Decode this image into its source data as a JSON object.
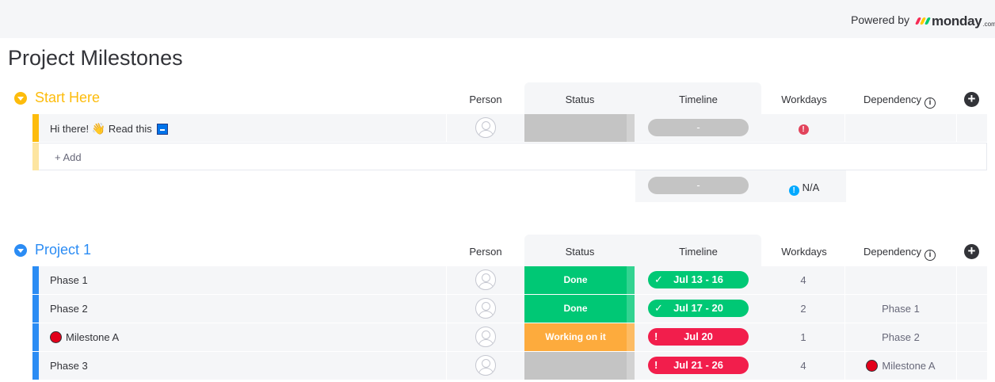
{
  "header": {
    "powered_by": "Powered by",
    "brand": "monday",
    "brand_suffix": ".com",
    "brand_colors": [
      "#f62b54",
      "#ffcb00",
      "#00ca72"
    ]
  },
  "page_title": "Project Milestones",
  "columns": {
    "person": "Person",
    "status": "Status",
    "timeline": "Timeline",
    "workdays": "Workdays",
    "dependency": "Dependency"
  },
  "groups": [
    {
      "title": "Start Here",
      "color": "#fdab3d",
      "title_color": "#fdbc0c",
      "rows": [
        {
          "name": "Hi there!",
          "name_suffix": "Read this",
          "status": "",
          "status_color": "#c4c4c4",
          "timeline": "-",
          "timeline_color": "#c4c4c4",
          "workdays_flag": "!",
          "dependency": ""
        }
      ],
      "add_label": "+ Add",
      "summary": {
        "timeline": "-",
        "workdays": "N/A"
      }
    },
    {
      "title": "Project 1",
      "color": "#579bfc",
      "title_color": "#2b8cf4",
      "rows": [
        {
          "name": "Phase 1",
          "status": "Done",
          "status_color": "#00c875",
          "timeline": "Jul 13 - 16",
          "timeline_color": "#00c875",
          "timeline_icon": "✓",
          "workdays": "4",
          "dependency": ""
        },
        {
          "name": "Phase 2",
          "status": "Done",
          "status_color": "#00c875",
          "timeline": "Jul 17 - 20",
          "timeline_color": "#00c875",
          "timeline_icon": "✓",
          "workdays": "2",
          "dependency": "Phase 1"
        },
        {
          "name": "Milestone A",
          "status": "Working on it",
          "status_color": "#fdab3d",
          "timeline": "Jul 20",
          "timeline_color": "#f21e4c",
          "timeline_icon": "!",
          "workdays": "1",
          "dependency": "Phase 2"
        },
        {
          "name": "Phase 3",
          "status": "",
          "status_color": "#c4c4c4",
          "timeline": "Jul 21 - 26",
          "timeline_color": "#f21e4c",
          "timeline_icon": "!",
          "workdays": "4",
          "dependency": "Milestone A"
        }
      ]
    }
  ]
}
